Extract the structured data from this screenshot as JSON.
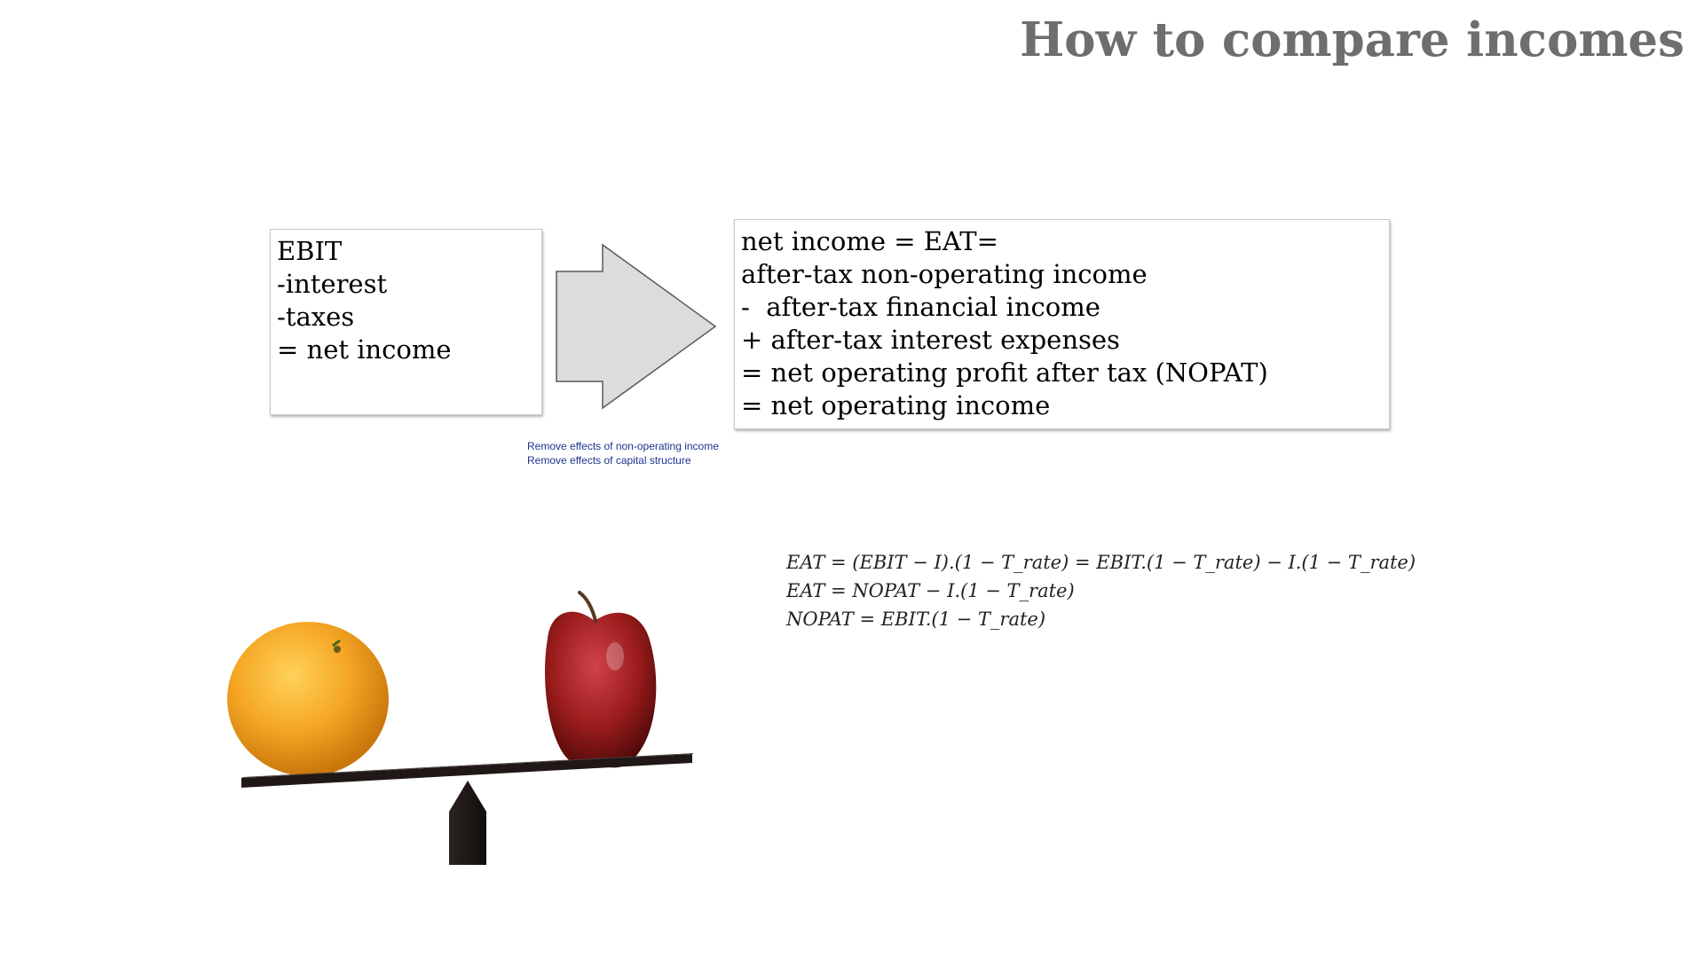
{
  "title": "How to compare incomes",
  "left_box": {
    "lines": [
      "EBIT",
      "-interest",
      "-taxes",
      "= net income"
    ]
  },
  "right_box": {
    "lines": [
      "net income = EAT=",
      "after-tax non-operating income",
      "-  after-tax financial income",
      "+ after-tax interest expenses",
      "= net operating profit after tax (NOPAT)",
      "= net operating income"
    ]
  },
  "arrow_notes": [
    "Remove effects of non-operating income",
    "Remove effects of capital structure"
  ],
  "formulas": [
    "EAT = (EBIT − I).(1 − T_rate) = EBIT.(1 − T_rate) − I.(1 − T_rate)",
    "EAT = NOPAT − I.(1 − T_rate)",
    "NOPAT = EBIT.(1 − T_rate)"
  ],
  "colors": {
    "title": "#6e6e6e",
    "notes": "#1f3390",
    "arrow_fill": "#dcdcdc",
    "orange": "#f5a623",
    "apple": "#9b1c1c"
  },
  "illustration": {
    "left_object": "orange",
    "right_object": "apple",
    "balance": "seesaw"
  }
}
